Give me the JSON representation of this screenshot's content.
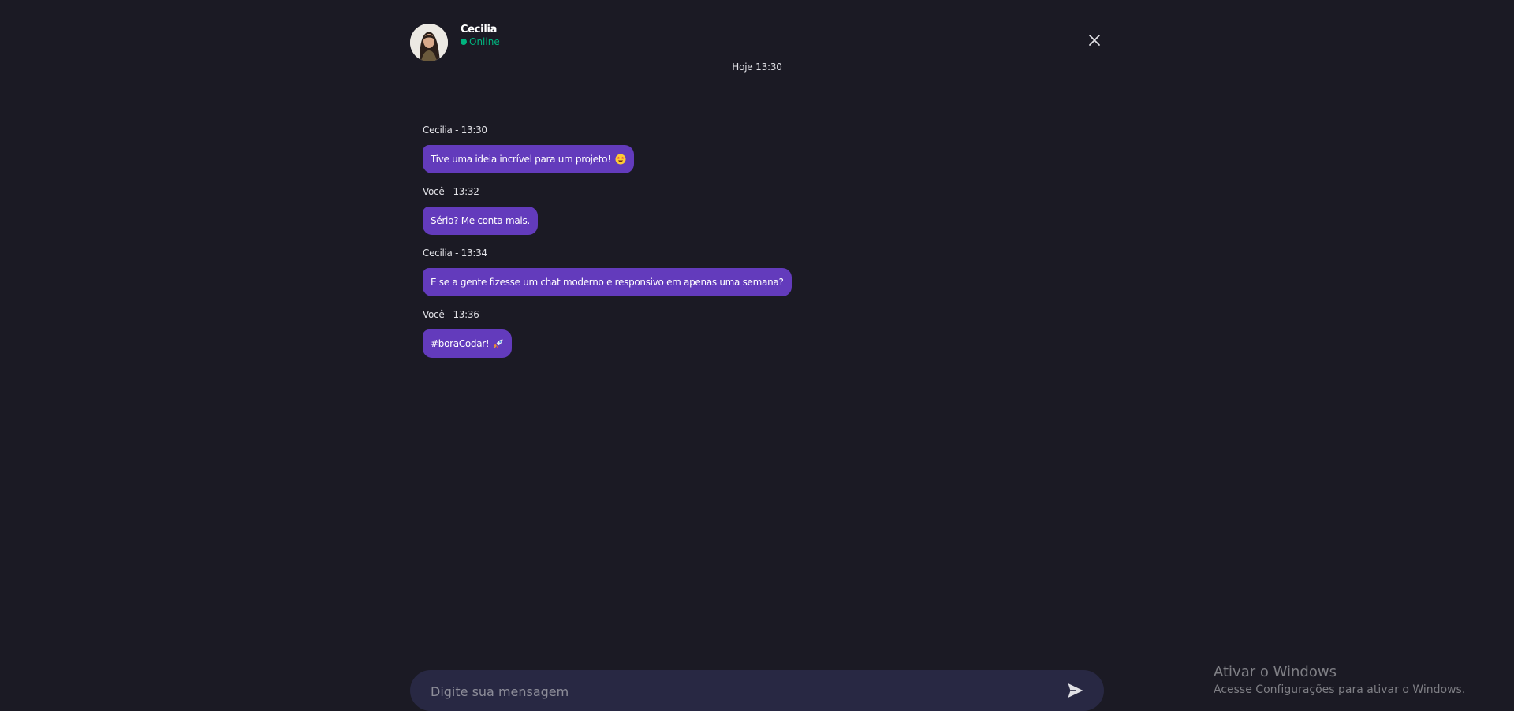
{
  "contact": {
    "name": "Cecilia",
    "status": "Online",
    "avatar_icon": "avatar-photo"
  },
  "header": {
    "close_icon": "close-icon"
  },
  "date_label": "Hoje 13:30",
  "messages": [
    {
      "meta": "Cecilia - 13:30",
      "text": "Tive uma ideia incrível para um projeto!",
      "emoji": "star-struck-emoji"
    },
    {
      "meta": "Você - 13:32",
      "text": "Sério? Me conta mais."
    },
    {
      "meta": "Cecilia - 13:34",
      "text": "E se a gente fizesse um chat moderno e responsivo em apenas uma semana?"
    },
    {
      "meta": "Você - 13:36",
      "text": "#boraCodar!",
      "emoji": "rocket-emoji"
    }
  ],
  "composer": {
    "placeholder": "Digite sua mensagem",
    "send_icon": "send-icon"
  },
  "watermark": {
    "title": "Ativar o Windows",
    "subtitle": "Acesse Configurações para ativar o Windows."
  },
  "colors": {
    "background": "#1b1a24",
    "bubble": "#633bbc",
    "online": "#00b37e",
    "composer": "#282843"
  }
}
